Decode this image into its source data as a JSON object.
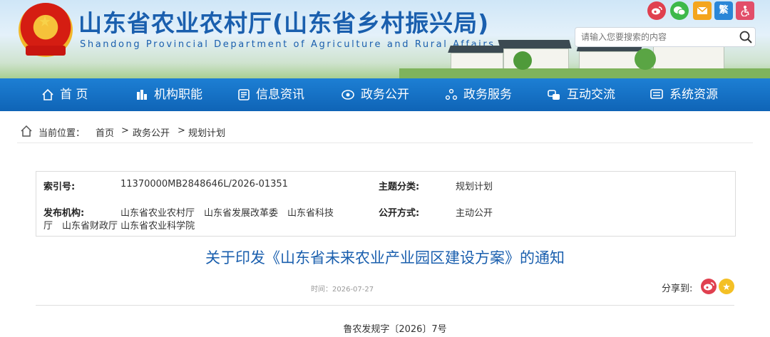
{
  "header": {
    "title": "山东省农业农村厅(山东省乡村振兴局)",
    "subtitle": "Shandong Provincial Department of Agriculture and Rural Affairs",
    "social": [
      {
        "name": "weibo-icon",
        "color": "#e0404f"
      },
      {
        "name": "wechat-icon",
        "color": "#3db94a"
      },
      {
        "name": "mail-icon",
        "color": "#f4a51c"
      },
      {
        "name": "traditional",
        "label": "繁",
        "color": "#2a86d7"
      },
      {
        "name": "accessibility-icon",
        "color": "#e24e6a"
      }
    ],
    "search": {
      "placeholder": "请输入您要搜索的内容"
    }
  },
  "nav": {
    "items": [
      {
        "label": "首 页",
        "icon": "home-icon"
      },
      {
        "label": "机构职能",
        "icon": "org-icon"
      },
      {
        "label": "信息资讯",
        "icon": "news-icon"
      },
      {
        "label": "政务公开",
        "icon": "disclosure-icon"
      },
      {
        "label": "政务服务",
        "icon": "service-icon"
      },
      {
        "label": "互动交流",
        "icon": "interaction-icon"
      },
      {
        "label": "系统资源",
        "icon": "resource-icon"
      }
    ]
  },
  "breadcrumb": {
    "prefix": "当前位置：",
    "items": [
      "首页",
      "政务公开",
      "规划计划"
    ],
    "separator": ">"
  },
  "meta": {
    "index_label": "索引号:",
    "index_value": "11370000MB2848646L/2026-01351",
    "topic_label": "主题分类:",
    "topic_value": "规划计划",
    "publisher_label": "发布机构:",
    "publisher_line1": "山东省农业农村厅　山东省发展改革委　山东省科技",
    "publisher_line2": "厅　山东省财政厅 山东省农业科学院",
    "mode_label": "公开方式:",
    "mode_value": "主动公开"
  },
  "article": {
    "title": "关于印发《山东省未来农业产业园区建设方案》的通知",
    "time": "时间：2026-07-27",
    "share_label": "分享到:",
    "doc_number": "鲁农发规字〔2026〕7号"
  },
  "colors": {
    "brand": "#1a5fae",
    "nav": "#1570c6"
  }
}
